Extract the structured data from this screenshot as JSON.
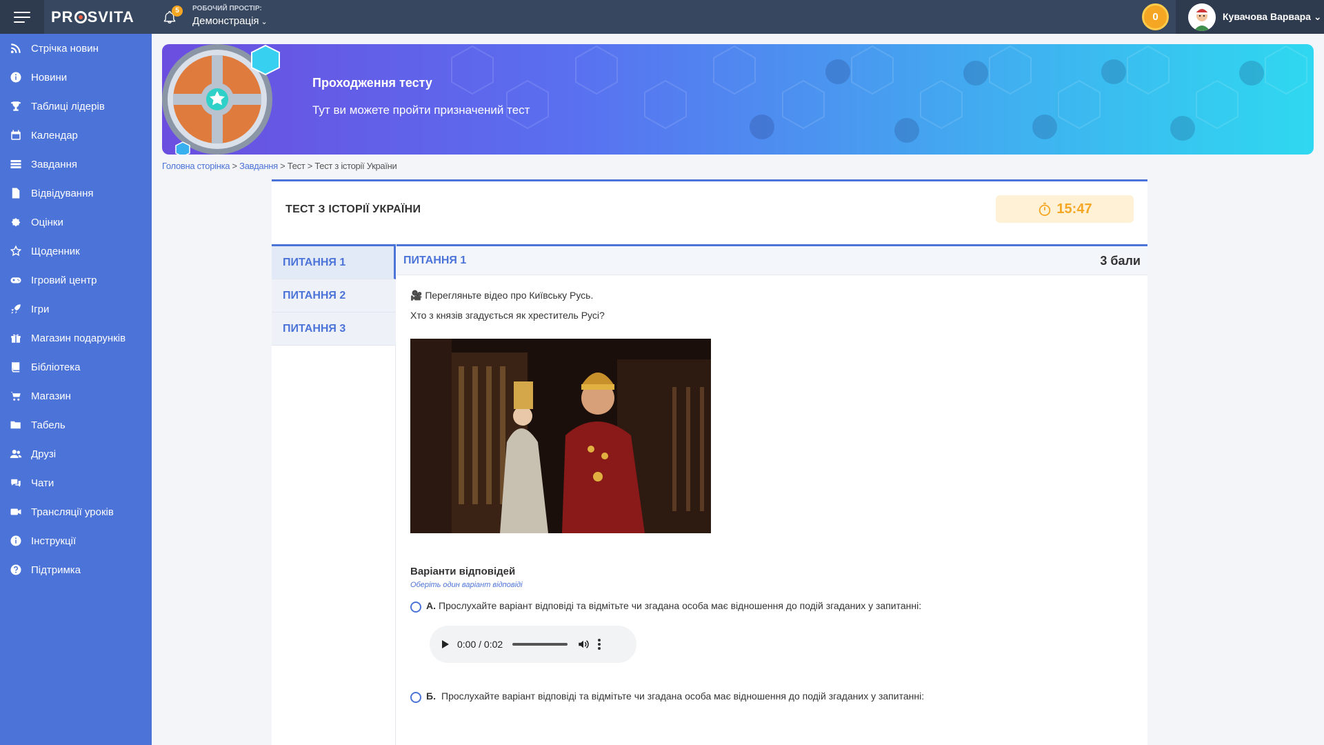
{
  "header": {
    "logo": "PR SVITA",
    "logo_left": "PR",
    "logo_right": "SVITA",
    "notifications_count": "5",
    "workspace_label": "РОБОЧИЙ ПРОСТІР:",
    "workspace_value": "Демонстрація",
    "coins": "0",
    "user_name": "Кувачова Варвара"
  },
  "sidebar": {
    "items": [
      {
        "label": "Стрічка новин",
        "icon": "rss-icon"
      },
      {
        "label": "Новини",
        "icon": "info-icon"
      },
      {
        "label": "Таблиці лідерів",
        "icon": "trophy-icon"
      },
      {
        "label": "Календар",
        "icon": "calendar-icon"
      },
      {
        "label": "Завдання",
        "icon": "tasks-icon"
      },
      {
        "label": "Відвідування",
        "icon": "document-icon"
      },
      {
        "label": "Оцінки",
        "icon": "badge-icon"
      },
      {
        "label": "Щоденник",
        "icon": "star-icon"
      },
      {
        "label": "Ігровий центр",
        "icon": "gamepad-icon"
      },
      {
        "label": "Ігри",
        "icon": "rocket-icon"
      },
      {
        "label": "Магазин подарунків",
        "icon": "gift-icon"
      },
      {
        "label": "Бібліотека",
        "icon": "book-icon"
      },
      {
        "label": "Магазин",
        "icon": "cart-icon"
      },
      {
        "label": "Табель",
        "icon": "folder-icon"
      },
      {
        "label": "Друзі",
        "icon": "users-icon"
      },
      {
        "label": "Чати",
        "icon": "chat-icon"
      },
      {
        "label": "Трансляції уроків",
        "icon": "video-icon"
      },
      {
        "label": "Інструкції",
        "icon": "info-icon"
      },
      {
        "label": "Підтримка",
        "icon": "help-icon"
      }
    ]
  },
  "banner": {
    "title": "Проходження тесту",
    "subtitle": "Тут ви можете пройти призначений тест"
  },
  "breadcrumb": {
    "home": "Головна сторінка",
    "sep1": " > ",
    "tasks": "Завдання",
    "rest": " > Тест > Тест з історії України"
  },
  "test": {
    "title": "ТЕСТ З ІСТОРІЇ УКРАЇНИ",
    "timer": "15:47",
    "questions": [
      {
        "label": "ПИТАННЯ 1"
      },
      {
        "label": "ПИТАННЯ 2"
      },
      {
        "label": "ПИТАННЯ 3"
      }
    ],
    "current": {
      "title": "ПИТАННЯ 1",
      "score": "3 бали",
      "text1": "🎥 Перегляньте відео про Київську Русь.",
      "text2": "Хто з князів згадується як хреститель Русі?",
      "answers_title": "Варіанти відповідей",
      "answers_hint": "Оберіть один варіант відповіді",
      "options": [
        {
          "letter": "А.",
          "text": "Прослухайте варіант відповіді та відмітьте чи згадана особа має відношення до подій згаданих у запитанні:"
        },
        {
          "letter": "Б.",
          "text": "Прослухайте варіант відповіді та відмітьте чи згадана особа має відношення до подій згаданих у запитанні:"
        }
      ],
      "audio_time": "0:00 / 0:02"
    }
  },
  "colors": {
    "accent": "#4b73d8",
    "topbar": "#37475f",
    "timer": "#f5a623"
  }
}
